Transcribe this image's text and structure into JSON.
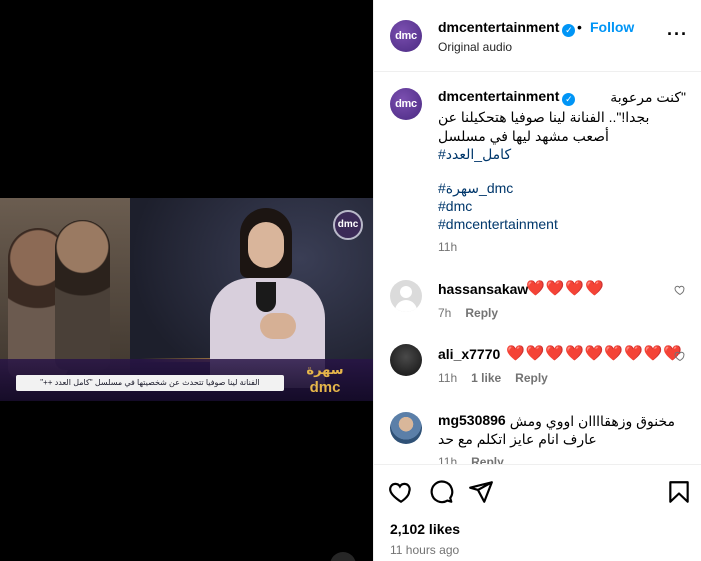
{
  "video": {
    "caption_text": "الفنانة لينا صوفيا تتحدث عن شخصيتها في مسلسل \"كامل العدد ++\"",
    "channel_logo": "dmc",
    "show_logo_arabic": "سهرة",
    "show_logo_latin": "dmc"
  },
  "post": {
    "author": "dmcentertainment",
    "follow_label": "Follow",
    "separator": "•",
    "audio_label": "Original audio",
    "more_icon": "more-icon"
  },
  "caption": {
    "username": "dmcentertainment",
    "line1": "\"كنت مرعوبة",
    "line2": "بجدا!\".. الفنانة لينا صوفيا هتحكيلنا عن",
    "line3": "أصعب مشهد ليها في مسلسل",
    "hashtag_series": "#كامل_العدد",
    "hashtag1": "#سهرة_dmc",
    "hashtag2": "#dmc",
    "hashtag3": "#dmcentertainment",
    "time": "11h"
  },
  "comments": [
    {
      "username": "hassansakaw",
      "text": "❤️❤️❤️❤️",
      "time": "7h",
      "reply": "Reply"
    },
    {
      "username": "ali_x7770",
      "text": "❤️❤️❤️❤️❤️❤️❤️❤️❤️",
      "time": "11h",
      "likes": "1 like",
      "reply": "Reply"
    },
    {
      "username": "mg530896",
      "text_line1": "مخنوق وزهقاااان اووي ومش",
      "text_line2": "عارف انام عايز اتكلم مع حد",
      "time": "11h",
      "reply": "Reply"
    }
  ],
  "footer": {
    "likes": "2,102 likes",
    "ago": "11 hours ago"
  },
  "colors": {
    "accent": "#0095f6",
    "hashtag": "#00376b",
    "muted": "#737373",
    "heart": "#e0245e"
  }
}
